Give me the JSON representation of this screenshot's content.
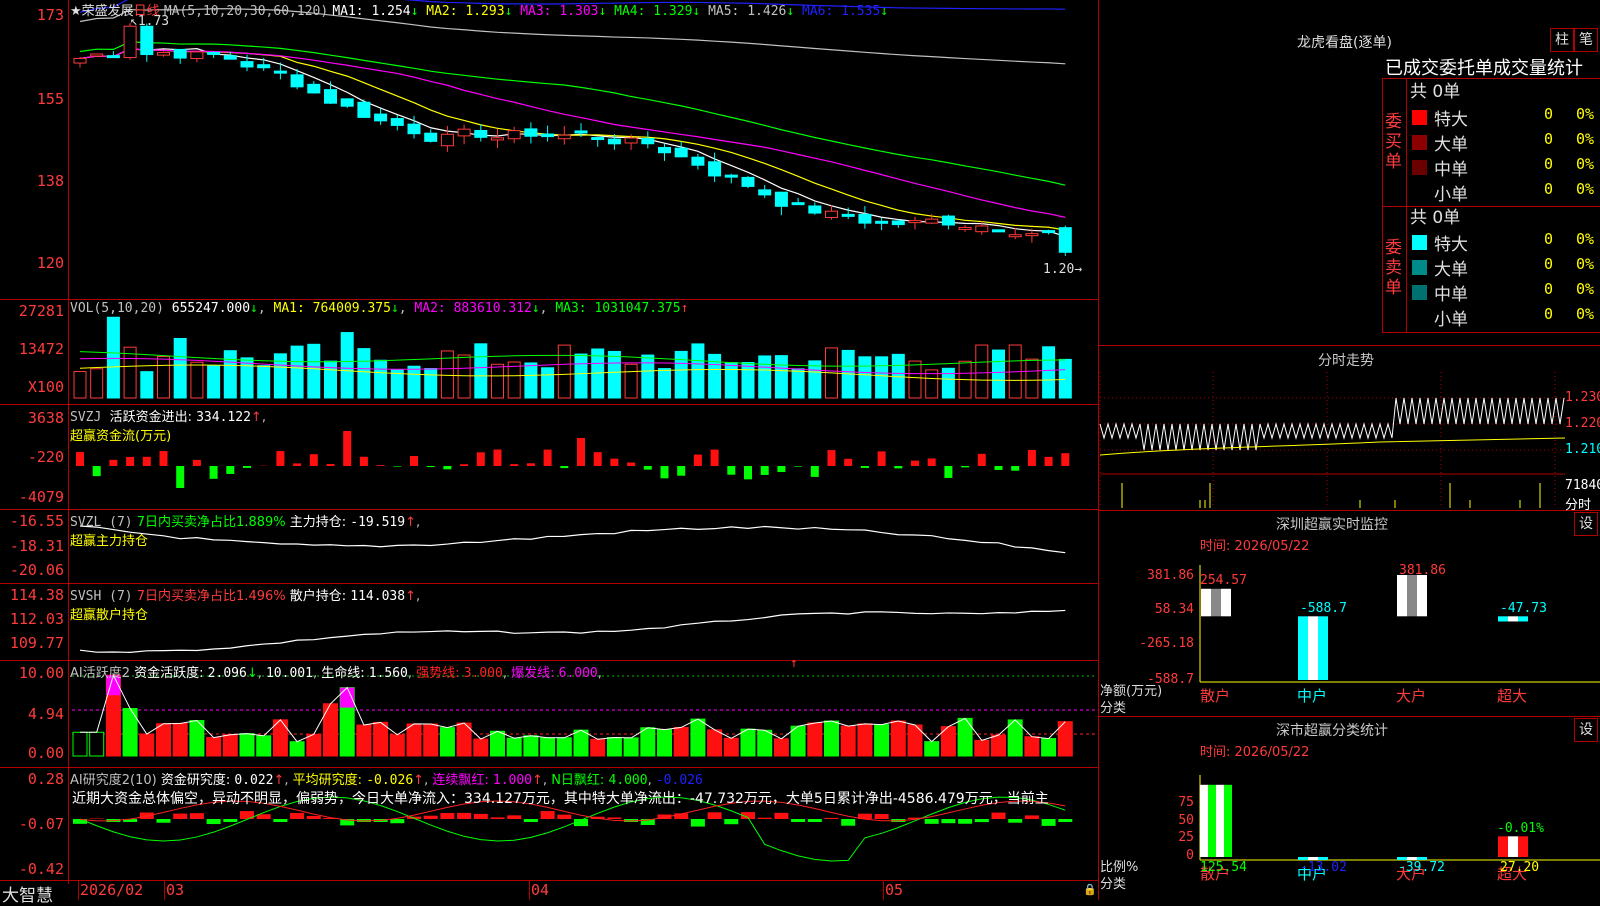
{
  "stock_name": "★荣盛发展",
  "period": "日线",
  "ma": {
    "label": "MA(5,10,20,30,60,120)",
    "items": [
      {
        "name": "MA1",
        "value": "1.254",
        "dir": "↓",
        "color": "#ffffff"
      },
      {
        "name": "MA2",
        "value": "1.293",
        "dir": "↓",
        "color": "#ffff00"
      },
      {
        "name": "MA3",
        "value": "1.303",
        "dir": "↓",
        "color": "#ff00ff"
      },
      {
        "name": "MA4",
        "value": "1.329",
        "dir": "↓",
        "color": "#00ff00"
      },
      {
        "name": "MA5",
        "value": "1.426",
        "dir": "↓",
        "color": "#c0c0c0"
      },
      {
        "name": "MA6",
        "value": "1.535",
        "dir": "↓",
        "color": "#2020ff"
      }
    ]
  },
  "price_axis": [
    "173",
    "155",
    "138",
    "120"
  ],
  "price_high_label": "1.73",
  "price_low_label": "1.20",
  "vol": {
    "label": "VOL(5,10,20)",
    "value": "655247.000",
    "dir": "↓",
    "ma1": "764009.375",
    "ma1_dir": "↓",
    "ma2": "883610.312",
    "ma2_dir": "↓",
    "ma3": "1031047.375",
    "ma3_dir": "↑",
    "axis": [
      "27281",
      "13472",
      "X100"
    ]
  },
  "svzj": {
    "label": "SVZJ",
    "text": "活跃资金进出:",
    "value": "334.122",
    "dir": "↑",
    "sub": "超赢资金流(万元)",
    "axis": [
      "3638",
      "-220",
      "-4079"
    ]
  },
  "svzl": {
    "label": "SVZL (7)",
    "text1": "7日内买卖净占比1.889%",
    "text2": "主力持仓:",
    "value": "-19.519",
    "dir": "↑",
    "sub": "超赢主力持仓",
    "axis": [
      "-16.55",
      "-18.31",
      "-20.06"
    ]
  },
  "svsh": {
    "label": "SVSH (7)",
    "text1": "7日内买卖净占比1.496%",
    "text2": "散户持仓:",
    "value": "114.038",
    "dir": "↑",
    "sub": "超赢散户持仓",
    "axis": [
      "114.38",
      "112.03",
      "109.77"
    ]
  },
  "ai1": {
    "label": "AI活跃度2",
    "a": "资金活跃度:",
    "av": "2.096",
    "ad": "↓",
    "b": "10.001",
    "c": "生命线:",
    "cv": "1.560",
    "d": "强势线:",
    "dv": "3.000",
    "e": "爆发线:",
    "ev": "6.000",
    "axis": [
      "10.00",
      "4.94",
      "0.00"
    ]
  },
  "ai2": {
    "label": "AI研究度2(10)",
    "a": "资金研究度:",
    "av": "0.022",
    "ad": "↑",
    "b": "平均研究度:",
    "bv": "-0.026",
    "bd": "↑",
    "c": "连续飘红:",
    "cv": "1.000",
    "cd": "↑",
    "d": "N日飘红:",
    "dv": "4.000",
    "e": "-0.026",
    "comment": "近期大资金总体偏空，异动不明显，偏弱势，今日大单净流入：334.127万元，其中特大单净流出：-47.732万元，大单5日累计净出-4586.479万元，当前主",
    "axis": [
      "0.28",
      "-0.07",
      "-0.42"
    ]
  },
  "date_axis": {
    "brand": "大智慧",
    "labels": [
      "2026/02",
      "03",
      "04",
      "05"
    ]
  },
  "longhu": {
    "title": "龙虎看盘(逐单)",
    "btn1": "柱",
    "btn2": "笔",
    "subtitle": "已成交委托单成交量统计",
    "buy_label": "委买单",
    "sell_label": "委卖单",
    "buy": {
      "total": "共 0单",
      "rows": [
        {
          "name": "特大",
          "count": "0",
          "pct": "0%",
          "color": "#ff0000"
        },
        {
          "name": "大单",
          "count": "0",
          "pct": "0%",
          "color": "#8b0000"
        },
        {
          "name": "中单",
          "count": "0",
          "pct": "0%",
          "color": "#6b0000"
        },
        {
          "name": "小单",
          "count": "0",
          "pct": "0%",
          "color": "#000000"
        }
      ]
    },
    "sell": {
      "total": "共 0单",
      "rows": [
        {
          "name": "特大",
          "count": "0",
          "pct": "0%",
          "color": "#00ffff"
        },
        {
          "name": "大单",
          "count": "0",
          "pct": "0%",
          "color": "#008b8b"
        },
        {
          "name": "中单",
          "count": "0",
          "pct": "0%",
          "color": "#007070"
        },
        {
          "name": "小单",
          "count": "0",
          "pct": "0%",
          "color": "#000000"
        }
      ]
    }
  },
  "intraday": {
    "title": "分时走势",
    "axis": [
      "1.230",
      "1.220",
      "1.210"
    ],
    "vol": "71840",
    "vol_unit": "分时"
  },
  "monitor": {
    "title": "深圳超赢实时监控",
    "btn": "设",
    "time": "时间: 2026/05/22",
    "axis": [
      "381.86",
      "58.34",
      "-265.18",
      "-588.7"
    ],
    "ylabel": "净额(万元)",
    "xlabel": "分类",
    "values": [
      "254.57",
      "-588.7",
      "381.86",
      "-47.73"
    ],
    "cats": [
      "散户",
      "中户",
      "大户",
      "超大"
    ]
  },
  "classify": {
    "title": "深市超赢分类统计",
    "btn": "设",
    "time": "时间: 2026/05/22",
    "axis": [
      "75",
      "50",
      "25",
      "0"
    ],
    "ylabel": "比例%",
    "xlabel": "分类",
    "values": [
      "125.54",
      "-13.02",
      "-39.72",
      "27.20"
    ],
    "top_label": "-0.01%",
    "cats": [
      "散户",
      "中户",
      "大户",
      "超大"
    ]
  }
}
